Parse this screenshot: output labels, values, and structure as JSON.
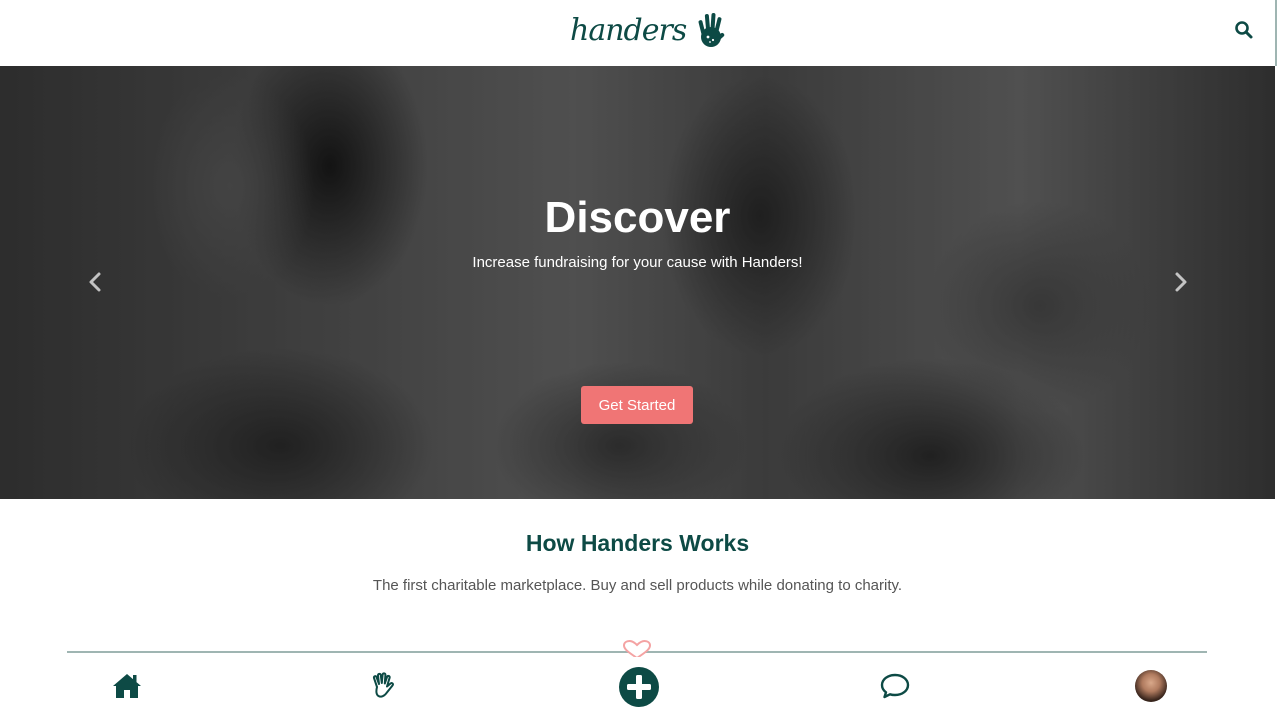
{
  "header": {
    "logo_text": "handers",
    "search_icon": "search-icon"
  },
  "hero": {
    "title": "Discover",
    "subtitle": "Increase fundraising for your cause with Handers!",
    "cta_label": "Get Started",
    "prev_icon": "chevron-left-icon",
    "next_icon": "chevron-right-icon"
  },
  "how": {
    "title_prefix": "How ",
    "title_brand": "Handers",
    "title_suffix": " Works",
    "subtitle": "The first charitable marketplace. Buy and sell products while donating to charity."
  },
  "bottom_nav": {
    "items": [
      "home-icon",
      "hand-icon",
      "plus-icon",
      "chat-icon",
      "avatar"
    ]
  },
  "colors": {
    "brand": "#0d4a45",
    "accent": "#f07575",
    "divider": "#9fb5b2"
  }
}
